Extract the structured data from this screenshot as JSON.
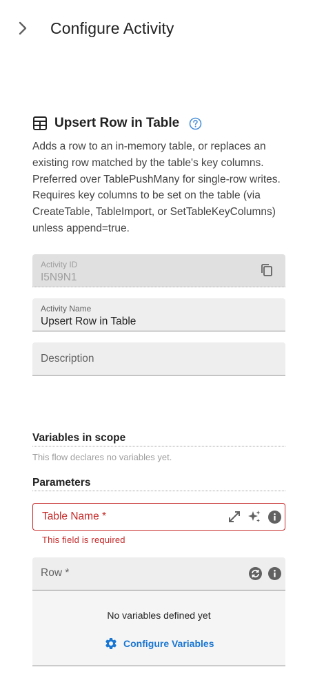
{
  "header": {
    "title": "Configure Activity",
    "collapse_icon": "chevron-right-icon"
  },
  "activity": {
    "icon": "table-icon",
    "title": "Upsert Row in Table",
    "help_icon": "help-circle-icon",
    "description": "Adds a row to an in-memory table, or replaces an existing row matched by the table's key columns. Preferred over TablePushMany for single-row writes. Requires key columns to be set on the table (via CreateTable, TableImport, or SetTableKeyColumns) unless append=true."
  },
  "fields": {
    "activity_id": {
      "label": "Activity ID",
      "value": "I5N9N1",
      "icon": "copy-icon"
    },
    "activity_name": {
      "label": "Activity Name",
      "value": "Upsert Row in Table"
    },
    "description": {
      "placeholder": "Description"
    }
  },
  "variables_section": {
    "heading": "Variables in scope",
    "empty_text": "This flow declares no variables yet."
  },
  "parameters": {
    "heading": "Parameters",
    "table_name": {
      "label": "Table Name *",
      "error": "This field is required",
      "icons": [
        "expand-icon",
        "sparkle-icon",
        "info-icon"
      ]
    },
    "row": {
      "label": "Row *",
      "icons": [
        "sync-icon",
        "info-icon"
      ],
      "empty_text": "No variables defined yet",
      "configure_label": "Configure Variables",
      "configure_icon": "gear-icon"
    }
  },
  "colors": {
    "accent": "#1976d2",
    "error": "#c62828",
    "help": "#4a90d9",
    "icon_gray": "#616161"
  }
}
